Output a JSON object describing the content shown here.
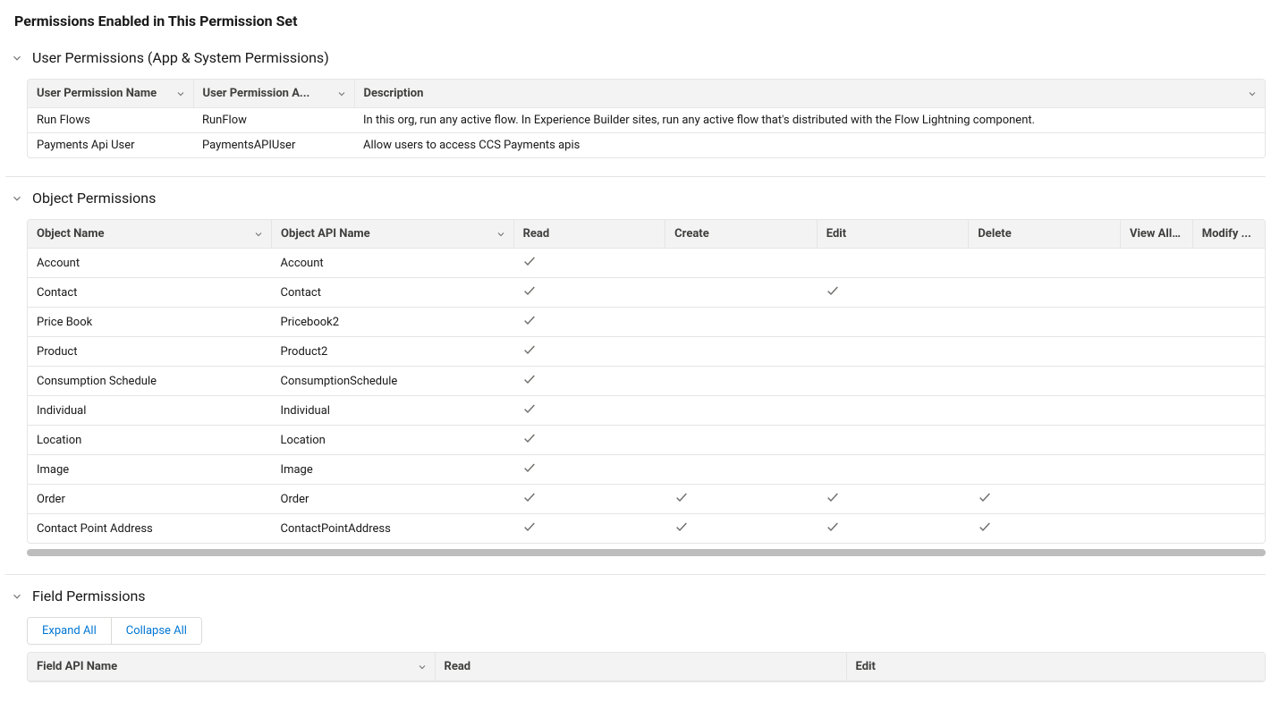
{
  "page_title": "Permissions Enabled in This Permission Set",
  "user_permissions": {
    "section_title": "User Permissions (App & System Permissions)",
    "columns": {
      "name": "User Permission Name",
      "api": "User Permission A...",
      "desc": "Description"
    },
    "rows": [
      {
        "name": "Run Flows",
        "api": "RunFlow",
        "desc": "In this org, run any active flow. In Experience Builder sites, run any active flow that's distributed with the Flow Lightning component."
      },
      {
        "name": "Payments Api User",
        "api": "PaymentsAPIUser",
        "desc": "Allow users to access CCS Payments apis"
      }
    ]
  },
  "object_permissions": {
    "section_title": "Object Permissions",
    "columns": {
      "object_name": "Object Name",
      "api_name": "Object API Name",
      "read": "Read",
      "create": "Create",
      "edit": "Edit",
      "delete": "Delete",
      "view_all": "View All ...",
      "modify": "Modify ..."
    },
    "rows": [
      {
        "name": "Account",
        "api": "Account",
        "read": true,
        "create": false,
        "edit": false,
        "delete": false
      },
      {
        "name": "Contact",
        "api": "Contact",
        "read": true,
        "create": false,
        "edit": true,
        "delete": false
      },
      {
        "name": "Price Book",
        "api": "Pricebook2",
        "read": true,
        "create": false,
        "edit": false,
        "delete": false
      },
      {
        "name": "Product",
        "api": "Product2",
        "read": true,
        "create": false,
        "edit": false,
        "delete": false
      },
      {
        "name": "Consumption Schedule",
        "api": "ConsumptionSchedule",
        "read": true,
        "create": false,
        "edit": false,
        "delete": false
      },
      {
        "name": "Individual",
        "api": "Individual",
        "read": true,
        "create": false,
        "edit": false,
        "delete": false
      },
      {
        "name": "Location",
        "api": "Location",
        "read": true,
        "create": false,
        "edit": false,
        "delete": false
      },
      {
        "name": "Image",
        "api": "Image",
        "read": true,
        "create": false,
        "edit": false,
        "delete": false
      },
      {
        "name": "Order",
        "api": "Order",
        "read": true,
        "create": true,
        "edit": true,
        "delete": true
      },
      {
        "name": "Contact Point Address",
        "api": "ContactPointAddress",
        "read": true,
        "create": true,
        "edit": true,
        "delete": true
      }
    ]
  },
  "field_permissions": {
    "section_title": "Field Permissions",
    "expand_all": "Expand All",
    "collapse_all": "Collapse All",
    "columns": {
      "field_api_name": "Field API Name",
      "read": "Read",
      "edit": "Edit"
    }
  }
}
